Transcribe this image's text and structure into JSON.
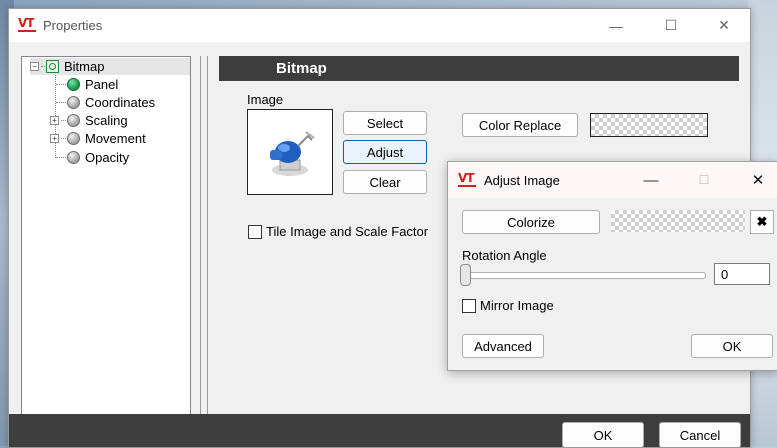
{
  "window": {
    "title": "Properties",
    "logo_text": "VT",
    "minimize_glyph": "—",
    "maximize_glyph": "☐",
    "close_glyph": "✕"
  },
  "tree": {
    "root": "Bitmap",
    "items": [
      {
        "label": "Panel",
        "icon": "green-ball-icon"
      },
      {
        "label": "Coordinates",
        "icon": "grey-ball-icon"
      },
      {
        "label": "Scaling",
        "icon": "grey-ball-icon",
        "expandable": true
      },
      {
        "label": "Movement",
        "icon": "grey-ball-icon",
        "expandable": true
      },
      {
        "label": "Opacity",
        "icon": "grey-ball-icon"
      }
    ],
    "expander_collapse": "−",
    "expander_expand": "+"
  },
  "panel": {
    "header": "Bitmap",
    "image_label": "Image",
    "select_label": "Select",
    "adjust_label": "Adjust",
    "clear_label": "Clear",
    "color_replace_label": "Color Replace",
    "tile_label": "Tile Image and Scale Factor"
  },
  "footer": {
    "ok_label": "OK",
    "cancel_label": "Cancel"
  },
  "adjust_dialog": {
    "title": "Adjust Image",
    "logo_text": "VT",
    "minimize_glyph": "—",
    "maximize_glyph": "☐",
    "close_glyph": "✕",
    "colorize_label": "Colorize",
    "clear_color_glyph": "✖",
    "rotation_label": "Rotation Angle",
    "rotation_value": "0",
    "rotation_slider_value": 0,
    "mirror_label": "Mirror Image",
    "advanced_label": "Advanced",
    "ok_label": "OK"
  },
  "colors": {
    "header_bg": "#3d3d3d",
    "logo_red": "#d0201e",
    "focus_blue": "#0067c0"
  }
}
